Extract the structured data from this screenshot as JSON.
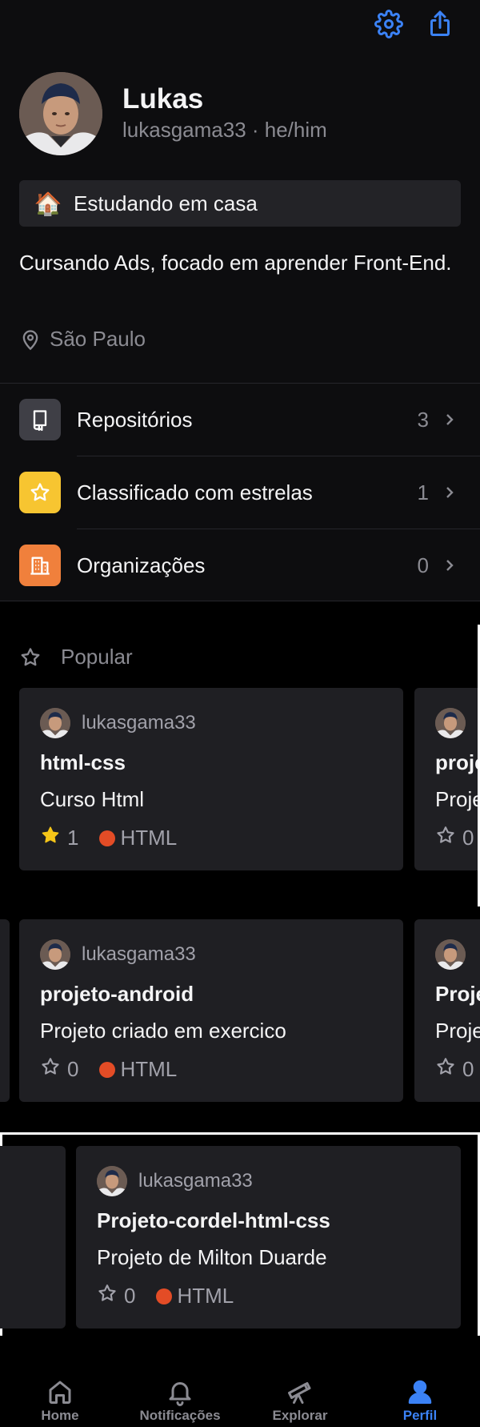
{
  "profile": {
    "name": "Lukas",
    "handle": "lukasgama33 · he/him",
    "status_emoji": "🏠",
    "status_text": "Estudando em casa",
    "bio": "Cursando Ads, focado em aprender Front-End.",
    "location": "São Paulo"
  },
  "menu": {
    "repositories": {
      "label": "Repositórios",
      "count": "3"
    },
    "starred": {
      "label": "Classificado com estrelas",
      "count": "1"
    },
    "organizations": {
      "label": "Organizações",
      "count": "0"
    }
  },
  "popular": {
    "heading": "Popular",
    "cards": [
      {
        "owner": "lukasgama33",
        "title": "html-css",
        "description": "Curso Html",
        "stars": "1",
        "starred": true,
        "language": "HTML"
      },
      {
        "owner": "lukasgama33",
        "title": "projeto-android",
        "description": "Projeto criado em exercico",
        "stars": "0",
        "starred": false,
        "language": "HTML"
      },
      {
        "owner": "lukasgama33",
        "title": "Projeto-cordel-html-css",
        "description": "Projeto de Milton Duarde",
        "stars": "0",
        "starred": false,
        "language": "HTML"
      }
    ],
    "peek": {
      "row1_title": "proje",
      "row1_desc": "Proje",
      "row1_stars": "0",
      "row2_title": "Proje",
      "row2_desc": "Proje",
      "row2_stars": "0"
    }
  },
  "tabs": {
    "home": "Home",
    "notifications": "Notificações",
    "explore": "Explorar",
    "profile": "Perfil"
  },
  "colors": {
    "accent": "#3b82f6",
    "repo_icon_bg": "#3f3f46",
    "star_icon_bg": "#f7c531",
    "org_icon_bg": "#f0803c",
    "html_language": "#e34c26",
    "star_filled": "#f5c518"
  },
  "icons": {
    "top_left": "gear-icon",
    "top_right": "share-icon"
  }
}
